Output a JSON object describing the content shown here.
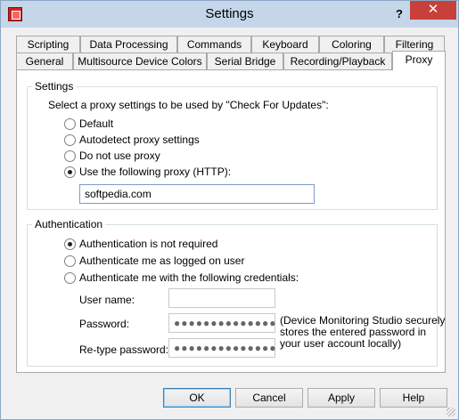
{
  "window": {
    "title": "Settings",
    "help_glyph": "?",
    "close_glyph": "✕"
  },
  "tabs_row1": [
    "Scripting",
    "Data Processing",
    "Commands",
    "Keyboard",
    "Coloring",
    "Filtering"
  ],
  "tabs_row2": [
    "General",
    "Multisource Device Colors",
    "Serial Bridge",
    "Recording/Playback",
    "Proxy"
  ],
  "active_tab": "Proxy",
  "settings": {
    "group_label": "Settings",
    "description": "Select a proxy settings to be used by \"Check For Updates\":",
    "options": [
      {
        "label": "Default",
        "checked": false
      },
      {
        "label": "Autodetect proxy settings",
        "checked": false
      },
      {
        "label": "Do not use proxy",
        "checked": false
      },
      {
        "label": "Use the following proxy (HTTP):",
        "checked": true
      }
    ],
    "proxy_value": "softpedia.com"
  },
  "authentication": {
    "group_label": "Authentication",
    "options": [
      {
        "label": "Authentication is not required",
        "checked": true
      },
      {
        "label": "Authenticate me as logged on user",
        "checked": false
      },
      {
        "label": "Authenticate me with the following credentials:",
        "checked": false
      }
    ],
    "username_label": "User name:",
    "username_value": "",
    "password_label": "Password:",
    "password_value": "●●●●●●●●●●●●●●",
    "retype_label": "Re-type password:",
    "retype_value": "●●●●●●●●●●●●●●",
    "note_line1": "(Device Monitoring Studio securely",
    "note_line2": "stores the entered password in",
    "note_line3": "your user account locally)"
  },
  "buttons": {
    "ok": "OK",
    "cancel": "Cancel",
    "apply": "Apply",
    "help": "Help"
  }
}
